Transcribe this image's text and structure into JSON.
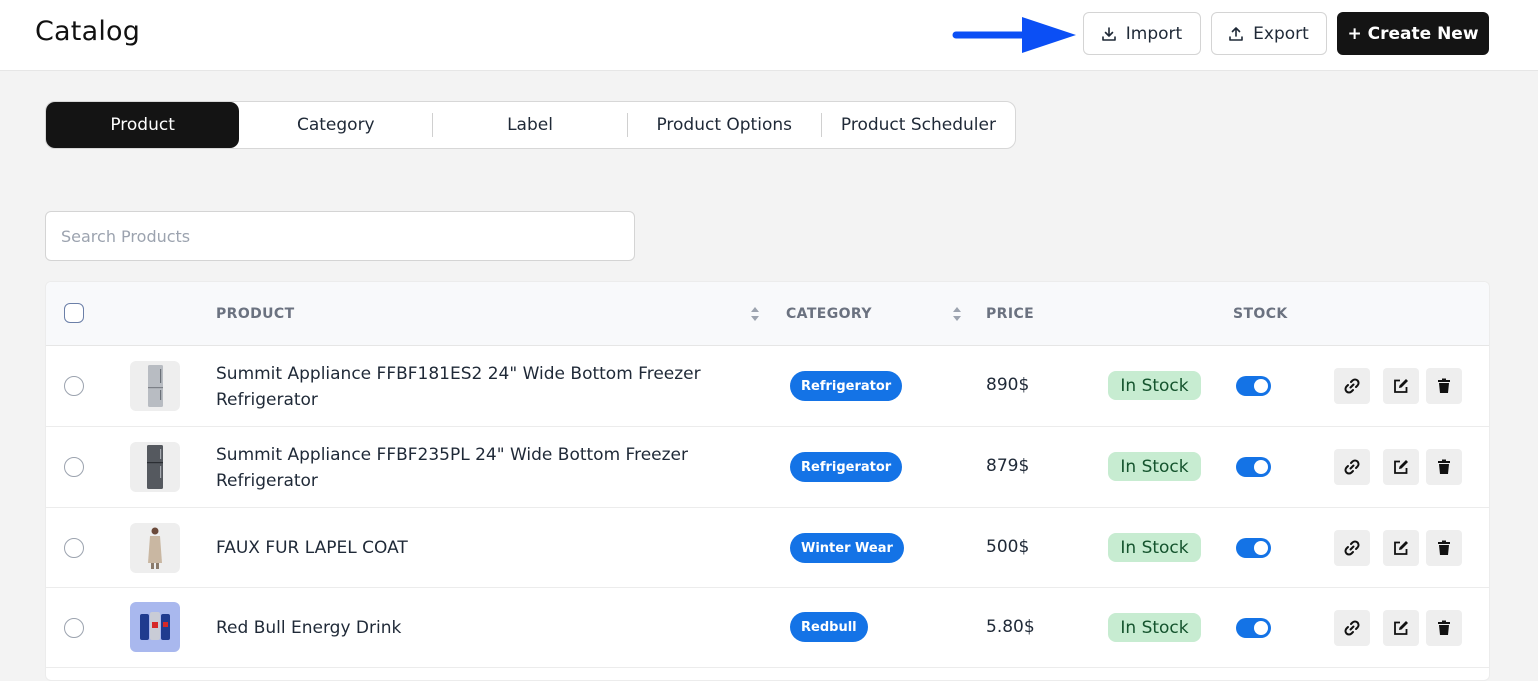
{
  "header": {
    "title": "Catalog",
    "import_label": "Import",
    "export_label": "Export",
    "create_label": "+ Create New"
  },
  "tabs": [
    {
      "label": "Product",
      "active": true
    },
    {
      "label": "Category",
      "active": false
    },
    {
      "label": "Label",
      "active": false
    },
    {
      "label": "Product Options",
      "active": false
    },
    {
      "label": "Product Scheduler",
      "active": false
    }
  ],
  "search": {
    "placeholder": "Search Products",
    "value": ""
  },
  "table": {
    "columns": {
      "product": "PRODUCT",
      "category": "CATEGORY",
      "price": "PRICE",
      "stock": "STOCK"
    },
    "rows": [
      {
        "name": "Summit Appliance FFBF181ES2 24\" Wide Bottom Freezer Refrigerator",
        "category": "Refrigerator",
        "price": "890$",
        "stock": "In Stock",
        "enabled": true,
        "thumb": "fridge-silver"
      },
      {
        "name": "Summit Appliance FFBF235PL 24\" Wide Bottom Freezer Refrigerator",
        "category": "Refrigerator",
        "price": "879$",
        "stock": "In Stock",
        "enabled": true,
        "thumb": "fridge-dark"
      },
      {
        "name": "FAUX FUR LAPEL COAT",
        "category": "Winter Wear",
        "price": "500$",
        "stock": "In Stock",
        "enabled": true,
        "thumb": "coat"
      },
      {
        "name": "Red Bull Energy Drink",
        "category": "Redbull",
        "price": "5.80$",
        "stock": "In Stock",
        "enabled": true,
        "thumb": "redbull"
      }
    ]
  },
  "colors": {
    "accent": "#1473e6",
    "dark": "#141414",
    "stock_bg": "#c7ecd1",
    "arrow": "#0b4ff5"
  },
  "icons": [
    "arrow-right-icon",
    "download-icon",
    "upload-icon",
    "sort-icon",
    "link-icon",
    "edit-icon",
    "trash-icon"
  ]
}
